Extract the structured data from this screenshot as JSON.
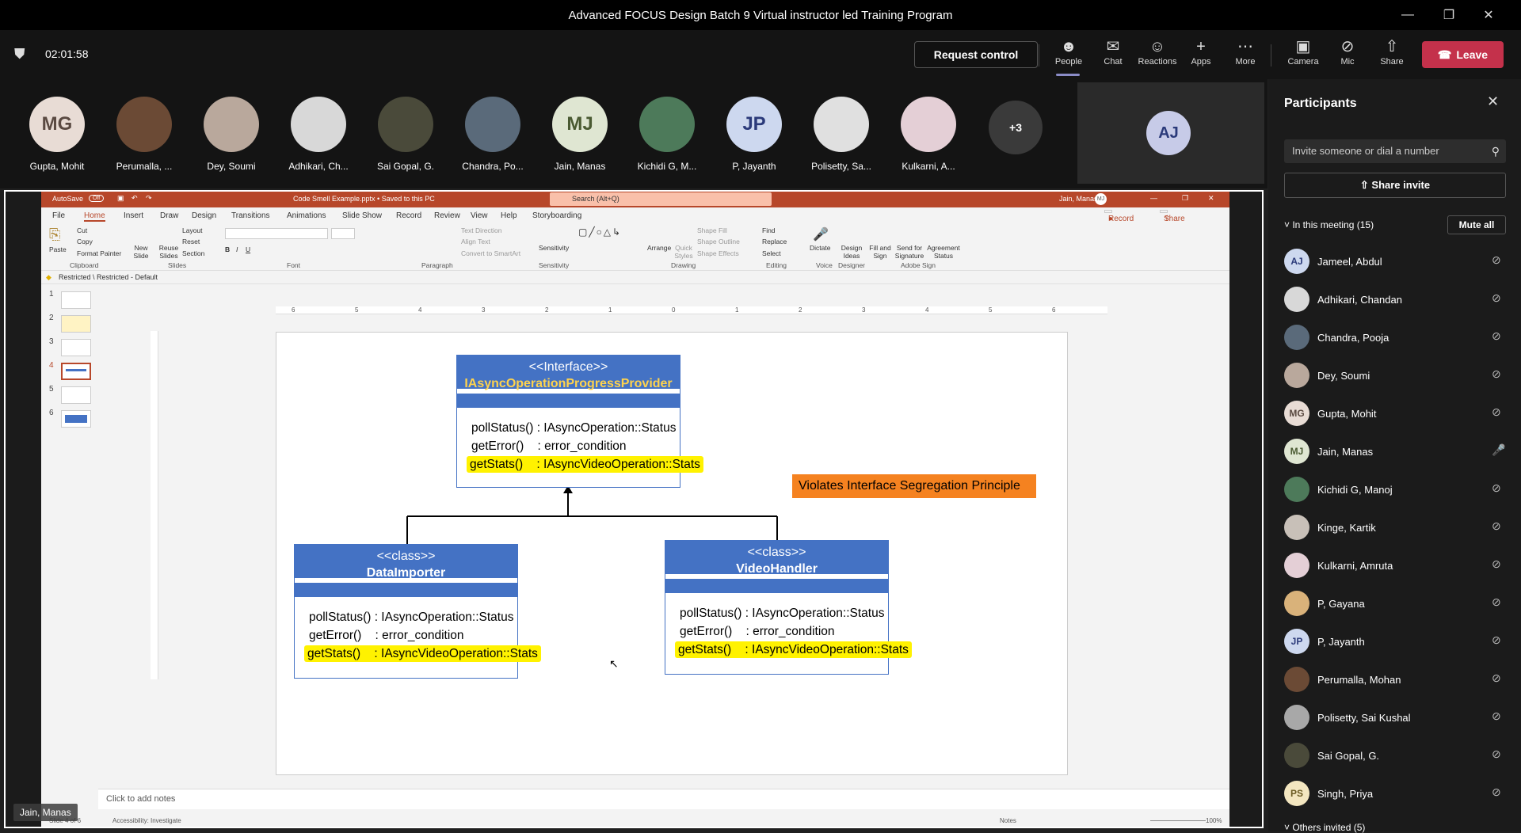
{
  "window": {
    "title": "Advanced FOCUS Design Batch 9 Virtual instructor led Training Program"
  },
  "meeting": {
    "timer": "02:01:58",
    "request_control": "Request control",
    "tools": [
      {
        "label": "People",
        "icon": "people-icon"
      },
      {
        "label": "Chat",
        "icon": "chat-icon"
      },
      {
        "label": "Reactions",
        "icon": "reactions-icon"
      },
      {
        "label": "Apps",
        "icon": "apps-icon"
      },
      {
        "label": "More",
        "icon": "more-icon"
      },
      {
        "label": "Camera",
        "icon": "camera-off-icon"
      },
      {
        "label": "Mic",
        "icon": "mic-off-icon"
      },
      {
        "label": "Share",
        "icon": "share-icon"
      }
    ],
    "leave": "Leave"
  },
  "strip": {
    "tiles": [
      {
        "name": "Gupta, Mohit",
        "initials": "MG"
      },
      {
        "name": "Perumalla, ...",
        "initials": ""
      },
      {
        "name": "Dey, Soumi",
        "initials": ""
      },
      {
        "name": "Adhikari, Ch...",
        "initials": ""
      },
      {
        "name": "Sai Gopal, G.",
        "initials": ""
      },
      {
        "name": "Chandra, Po...",
        "initials": ""
      },
      {
        "name": "Jain, Manas",
        "initials": "MJ"
      },
      {
        "name": "Kichidi G, M...",
        "initials": ""
      },
      {
        "name": "P, Jayanth",
        "initials": "JP"
      },
      {
        "name": "Polisetty, Sa...",
        "initials": ""
      },
      {
        "name": "Kulkarni, A...",
        "initials": ""
      }
    ],
    "overflow": "+3",
    "self_initials": "AJ"
  },
  "ppt": {
    "autosave": "AutoSave",
    "autosave_state": "Off",
    "file": "Code Smell Example.pptx • Saved to this PC",
    "search": "Search (Alt+Q)",
    "user": "Jain, Manas",
    "user_initials": "MJ",
    "tabs": [
      "File",
      "Home",
      "Insert",
      "Draw",
      "Design",
      "Transitions",
      "Animations",
      "Slide Show",
      "Record",
      "Review",
      "View",
      "Help",
      "Storyboarding"
    ],
    "record": "Record",
    "share": "Share",
    "ribbon_groups": [
      "Clipboard",
      "Slides",
      "Font",
      "Paragraph",
      "Sensitivity",
      "Drawing",
      "Editing",
      "Voice",
      "Designer",
      "Adobe Sign"
    ],
    "ribbon_buttons": {
      "paste": "Paste",
      "cut": "Cut",
      "copy": "Copy",
      "format_painter": "Format Painter",
      "new_slide": "New Slide",
      "reuse_slides": "Reuse Slides",
      "layout": "Layout",
      "reset": "Reset",
      "section": "Section",
      "text_direction": "Text Direction",
      "align_text": "Align Text",
      "convert_smartart": "Convert to SmartArt",
      "sensitivity": "Sensitivity",
      "arrange": "Arrange",
      "quick_styles": "Quick Styles",
      "shape_fill": "Shape Fill",
      "shape_outline": "Shape Outline",
      "shape_effects": "Shape Effects",
      "find": "Find",
      "replace": "Replace",
      "select": "Select",
      "dictate": "Dictate",
      "design_ideas": "Design Ideas",
      "fill_sign": "Fill and Sign",
      "send_signature": "Send for Signature",
      "agreement_status": "Agreement Status"
    },
    "sensitivity_label": "Restricted \\ Restricted - Default",
    "slide_numbers": [
      "1",
      "2",
      "3",
      "4",
      "5",
      "6"
    ],
    "active_slide": "4",
    "ruler_ticks": [
      "6",
      "5",
      "4",
      "3",
      "2",
      "1",
      "0",
      "1",
      "2",
      "3",
      "4",
      "5",
      "6"
    ],
    "notes_placeholder": "Click to add notes",
    "status": {
      "slide": "Slide 4 of 6",
      "accessibility": "Accessibility: Investigate",
      "notes": "Notes",
      "zoom": "100%"
    }
  },
  "slide": {
    "interface": {
      "stereotype": "<<Interface>>",
      "name": "IAsyncOperationProgressProvider",
      "methods": [
        {
          "text": "pollStatus() : IAsyncOperation::Status",
          "highlight": false
        },
        {
          "text": "getError()    : error_condition",
          "highlight": false
        },
        {
          "text": "getStats()    : IAsyncVideoOperation::Stats",
          "highlight": true
        }
      ]
    },
    "note": "Violates Interface Segregation Principle",
    "classes": [
      {
        "stereotype": "<<class>>",
        "name": "DataImporter",
        "methods": [
          {
            "text": "pollStatus() : IAsyncOperation::Status",
            "highlight": false
          },
          {
            "text": "getError()    : error_condition",
            "highlight": false
          },
          {
            "text": "getStats()    : IAsyncVideoOperation::Stats",
            "highlight": true
          }
        ]
      },
      {
        "stereotype": "<<class>>",
        "name": "VideoHandler",
        "methods": [
          {
            "text": "pollStatus() : IAsyncOperation::Status",
            "highlight": false
          },
          {
            "text": "getError()    : error_condition",
            "highlight": false
          },
          {
            "text": "getStats()    : IAsyncVideoOperation::Stats",
            "highlight": true
          }
        ]
      }
    ],
    "presenter_tag": "Jain, Manas"
  },
  "panel": {
    "title": "Participants",
    "invite_placeholder": "Invite someone or dial a number",
    "share_invite": "Share invite",
    "in_meeting": "In this meeting (15)",
    "mute_all": "Mute all",
    "participants": [
      {
        "name": "Jameel, Abdul",
        "initials": "AJ",
        "mic": "muted"
      },
      {
        "name": "Adhikari, Chandan",
        "initials": "",
        "mic": "muted"
      },
      {
        "name": "Chandra, Pooja",
        "initials": "",
        "mic": "muted"
      },
      {
        "name": "Dey, Soumi",
        "initials": "",
        "mic": "muted"
      },
      {
        "name": "Gupta, Mohit",
        "initials": "MG",
        "mic": "muted"
      },
      {
        "name": "Jain, Manas",
        "initials": "MJ",
        "mic": "on"
      },
      {
        "name": "Kichidi G, Manoj",
        "initials": "",
        "mic": "muted"
      },
      {
        "name": "Kinge, Kartik",
        "initials": "",
        "mic": "muted"
      },
      {
        "name": "Kulkarni, Amruta",
        "initials": "",
        "mic": "muted"
      },
      {
        "name": "P, Gayana",
        "initials": "",
        "mic": "muted"
      },
      {
        "name": "P, Jayanth",
        "initials": "JP",
        "mic": "muted"
      },
      {
        "name": "Perumalla, Mohan",
        "initials": "",
        "mic": "muted"
      },
      {
        "name": "Polisetty, Sai Kushal",
        "initials": "",
        "mic": "muted"
      },
      {
        "name": "Sai Gopal, G.",
        "initials": "",
        "mic": "muted"
      },
      {
        "name": "Singh, Priya",
        "initials": "PS",
        "mic": "muted"
      }
    ],
    "others_invited": "Others invited (5)"
  },
  "colors": {
    "leave": "#c4314b",
    "ppt_brand": "#b7472a",
    "uml_blue": "#4472c4",
    "highlight": "#fff200",
    "note_orange": "#f58220",
    "interface_name": "#ffd34d"
  }
}
